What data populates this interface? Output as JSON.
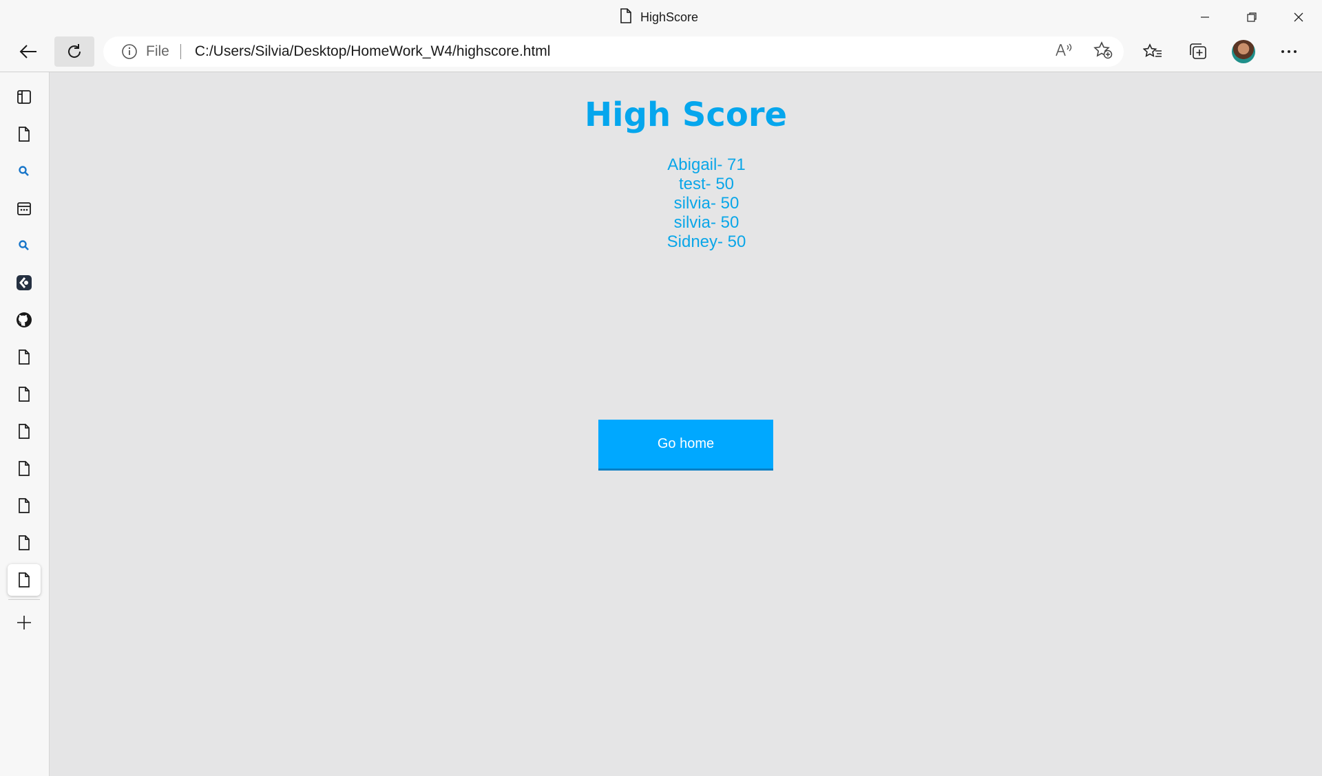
{
  "window": {
    "tab_title": "HighScore",
    "controls": [
      "minimize-icon",
      "restore-icon",
      "close-icon"
    ]
  },
  "toolbar": {
    "address_prefix": "File",
    "url": "C:/Users/Silvia/Desktop/HomeWork_W4/highscore.html",
    "icons": [
      "back-arrow-icon",
      "refresh-icon",
      "info-icon",
      "read-aloud-icon",
      "add-favorite-icon",
      "favorites-icon",
      "collections-icon",
      "profile-avatar",
      "more-menu-icon"
    ]
  },
  "sidebar": {
    "items": [
      "vertical-tabs-icon",
      "page-icon",
      "search-icon",
      "calendar-icon",
      "search-icon",
      "dark-app-icon",
      "github-icon",
      "page-icon",
      "page-icon",
      "page-icon",
      "page-icon",
      "page-icon",
      "page-icon",
      "page-icon",
      "add-icon"
    ]
  },
  "page": {
    "title": "High Score",
    "scores": [
      "Abigail- 71",
      "test- 50",
      "silvia- 50",
      "silvia- 50",
      "Sidney- 50"
    ],
    "go_home_label": "Go home"
  },
  "colors": {
    "accent": "#05a6ed",
    "button": "#00a8ff",
    "content_bg": "#e5e5e6"
  }
}
